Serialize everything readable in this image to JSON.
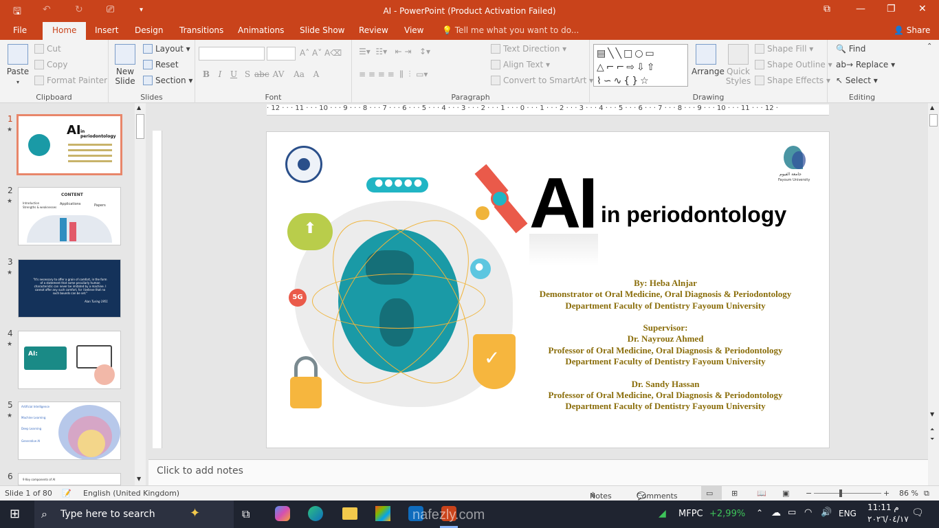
{
  "window": {
    "title": "AI - PowerPoint (Product Activation Failed)"
  },
  "tabs": [
    "File",
    "Home",
    "Insert",
    "Design",
    "Transitions",
    "Animations",
    "Slide Show",
    "Review",
    "View"
  ],
  "tell_me": "Tell me what you want to do...",
  "share_label": "Share",
  "clipboard": {
    "paste": "Paste",
    "cut": "Cut",
    "copy": "Copy",
    "format_painter": "Format Painter",
    "label": "Clipboard"
  },
  "slides_group": {
    "new_slide": "New Slide",
    "layout": "Layout",
    "reset": "Reset",
    "section": "Section",
    "label": "Slides"
  },
  "font_group": {
    "label": "Font"
  },
  "paragraph_group": {
    "label": "Paragraph",
    "text_direction": "Text Direction",
    "align_text": "Align Text",
    "convert_smartart": "Convert to SmartArt"
  },
  "drawing_group": {
    "label": "Drawing",
    "arrange": "Arrange",
    "quick_styles": "Quick Styles",
    "shape_fill": "Shape Fill",
    "shape_outline": "Shape Outline",
    "shape_effects": "Shape Effects"
  },
  "editing_group": {
    "label": "Editing",
    "find": "Find",
    "replace": "Replace",
    "select": "Select"
  },
  "ruler_h": "· 12 · · · 11 · · · 10 · · · 9 · · · 8 · · · 7 · · · 6 · · · 5 · · · 4 · · · 3 · · · 2 · · · 1 · · · 0 · · · 1 · · · 2 · · · 3 · · · 4 · · · 5 · · · 6 · · · 7 · · · 8 · · · 9 · · · 10 · · · 11 · · · 12 ·",
  "thumbnails": [
    {
      "num": "1",
      "title": "AI",
      "subtitle": "in periodontology"
    },
    {
      "num": "2",
      "heading": "CONTENT",
      "items": [
        "Introduction",
        "Strengths & weaknesses",
        "Applications",
        "Papers"
      ]
    },
    {
      "num": "3",
      "quote": "\"It's necessary to offer a grain of comfort, in the form of a statement that some peculiarly human characteristic can never be imitated by a machine. I cannot offer any such comfort, for I believe that no such bounds can be set.\"",
      "author": "Alan Turing 1951"
    },
    {
      "num": "4",
      "label": "AI:"
    },
    {
      "num": "5",
      "items": [
        "Artificial Intelligence",
        "Machine Learning",
        "Deep Learning",
        "Generative AI"
      ]
    },
    {
      "num": "6",
      "heading": "9 Key components of AI"
    }
  ],
  "slide": {
    "title_big": "AI",
    "title_rest": "in periodontology",
    "badge_5g": "5G",
    "logo_right_arabic": "جامعة الفيوم",
    "logo_right_en": "Fayoum University",
    "author_lines": [
      "By: Heba Alnjar",
      "Demonstrator ot Oral Medicine, Oral Diagnosis & Periodontology",
      "Department Faculty of Dentistry Fayoum University",
      "",
      "Supervisor:",
      "Dr. Nayrouz Ahmed",
      "Professor of Oral Medicine, Oral Diagnosis & Periodontology",
      "Department Faculty of Dentistry Fayoum University",
      "",
      "Dr. Sandy Hassan",
      "Professor of Oral Medicine, Oral Diagnosis & Periodontology",
      "Department Faculty of Dentistry Fayoum University"
    ]
  },
  "notes_placeholder": "Click to add notes",
  "status": {
    "slide": "Slide 1 of 80",
    "language": "English (United Kingdom)",
    "notes": "Notes",
    "comments": "Comments",
    "zoom": "86 %"
  },
  "taskbar": {
    "search": "Type here to search",
    "stock": "MFPC",
    "stock_change": "+2,99%",
    "lang": "ENG",
    "time": "11:11 م",
    "date": "٢٠٢٦/٠٤/١٧",
    "watermark": "nafezly.com"
  },
  "colors": {
    "accent": "#c9431b",
    "gold": "#8a6d0a",
    "teal": "#1a9aa6"
  }
}
